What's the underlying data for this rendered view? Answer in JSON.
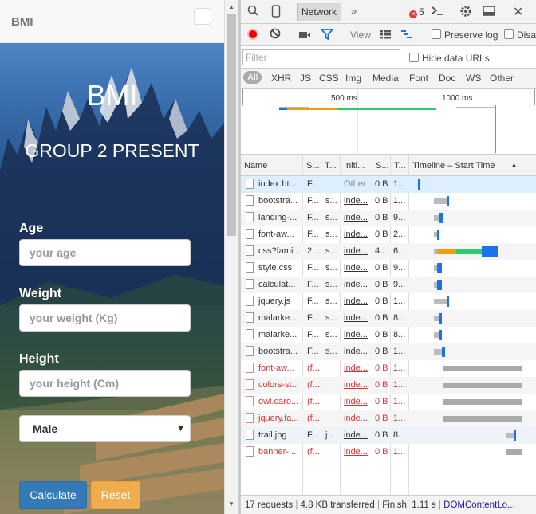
{
  "navbar": {
    "brand": "BMI"
  },
  "hero": {
    "title": "BMI",
    "subtitle": "GROUP 2 PRESENT"
  },
  "form": {
    "age_label": "Age",
    "age_placeholder": "your age",
    "weight_label": "Weight",
    "weight_placeholder": "your weight (Kg)",
    "height_label": "Height",
    "height_placeholder": "your height (Cm)",
    "sex_selected": "Male",
    "calculate_label": "Calculate",
    "reset_label": "Reset"
  },
  "devtools": {
    "active_tab": "Network",
    "more": "»",
    "error_count": "5",
    "view_label": "View:",
    "preserve_log": "Preserve log",
    "disable_cache": "Disa",
    "filter_placeholder": "Filter",
    "hide_data_urls": "Hide data URLs",
    "types": [
      "All",
      "XHR",
      "JS",
      "CSS",
      "Img",
      "Media",
      "Font",
      "Doc",
      "WS",
      "Other"
    ],
    "overview_ticks": [
      "500 ms",
      "1000 ms"
    ],
    "columns": [
      "Name",
      "S...",
      "T...",
      "Initi...",
      "S...",
      "T...",
      "Timeline – Start Time"
    ],
    "rows": [
      {
        "name": "index.ht...",
        "status": "F...",
        "type": "",
        "initiator": "Other",
        "size": "0 B",
        "time": "1...",
        "style": "sel"
      },
      {
        "name": "bootstra...",
        "status": "F...",
        "type": "s...",
        "initiator": "inde...",
        "size": "0 B",
        "time": "1...",
        "style": ""
      },
      {
        "name": "landing-...",
        "status": "F...",
        "type": "s...",
        "initiator": "inde...",
        "size": "0 B",
        "time": "9...",
        "style": "alt"
      },
      {
        "name": "font-aw...",
        "status": "F...",
        "type": "s...",
        "initiator": "inde...",
        "size": "0 B",
        "time": "2...",
        "style": ""
      },
      {
        "name": "css?fami...",
        "status": "2...",
        "type": "s...",
        "initiator": "inde...",
        "size": "4...",
        "time": "6...",
        "style": "alt"
      },
      {
        "name": "style.css",
        "status": "F...",
        "type": "s...",
        "initiator": "inde...",
        "size": "0 B",
        "time": "9...",
        "style": ""
      },
      {
        "name": "calculat...",
        "status": "F...",
        "type": "s...",
        "initiator": "inde...",
        "size": "0 B",
        "time": "9...",
        "style": "alt"
      },
      {
        "name": "jquery.js",
        "status": "F...",
        "type": "s...",
        "initiator": "inde...",
        "size": "0 B",
        "time": "1...",
        "style": ""
      },
      {
        "name": "malarke...",
        "status": "F...",
        "type": "s...",
        "initiator": "inde...",
        "size": "0 B",
        "time": "8...",
        "style": "alt"
      },
      {
        "name": "malarke...",
        "status": "F...",
        "type": "s...",
        "initiator": "inde...",
        "size": "0 B",
        "time": "8...",
        "style": ""
      },
      {
        "name": "bootstra...",
        "status": "F...",
        "type": "s...",
        "initiator": "inde...",
        "size": "0 B",
        "time": "1...",
        "style": "alt"
      },
      {
        "name": "font-aw...",
        "status": "(f...",
        "type": "",
        "initiator": "inde...",
        "size": "0 B",
        "time": "1...",
        "style": "red"
      },
      {
        "name": "colors-st...",
        "status": "(f...",
        "type": "",
        "initiator": "inde...",
        "size": "0 B",
        "time": "1...",
        "style": "red alt"
      },
      {
        "name": "owl.caro...",
        "status": "(f...",
        "type": "",
        "initiator": "inde...",
        "size": "0 B",
        "time": "1...",
        "style": "red"
      },
      {
        "name": "jquery.fa...",
        "status": "(f...",
        "type": "",
        "initiator": "inde...",
        "size": "0 B",
        "time": "1...",
        "style": "red alt"
      },
      {
        "name": "trail.jpg",
        "status": "F...",
        "type": "j...",
        "initiator": "inde...",
        "size": "0 B",
        "time": "8...",
        "style": "mid"
      },
      {
        "name": "banner-...",
        "status": "(f...",
        "type": "",
        "initiator": "inde...",
        "size": "0 B",
        "time": "1...",
        "style": "red"
      }
    ],
    "status": {
      "requests": "17 requests",
      "transferred": "4.8 KB transferred",
      "finish": "Finish: 1.11 s",
      "dcl": "DOMContentLo..."
    }
  },
  "colors": {
    "primary": "#337ab7",
    "warning": "#f0ad4e",
    "record": "#e00000",
    "filter_active": "#1a73e8"
  }
}
